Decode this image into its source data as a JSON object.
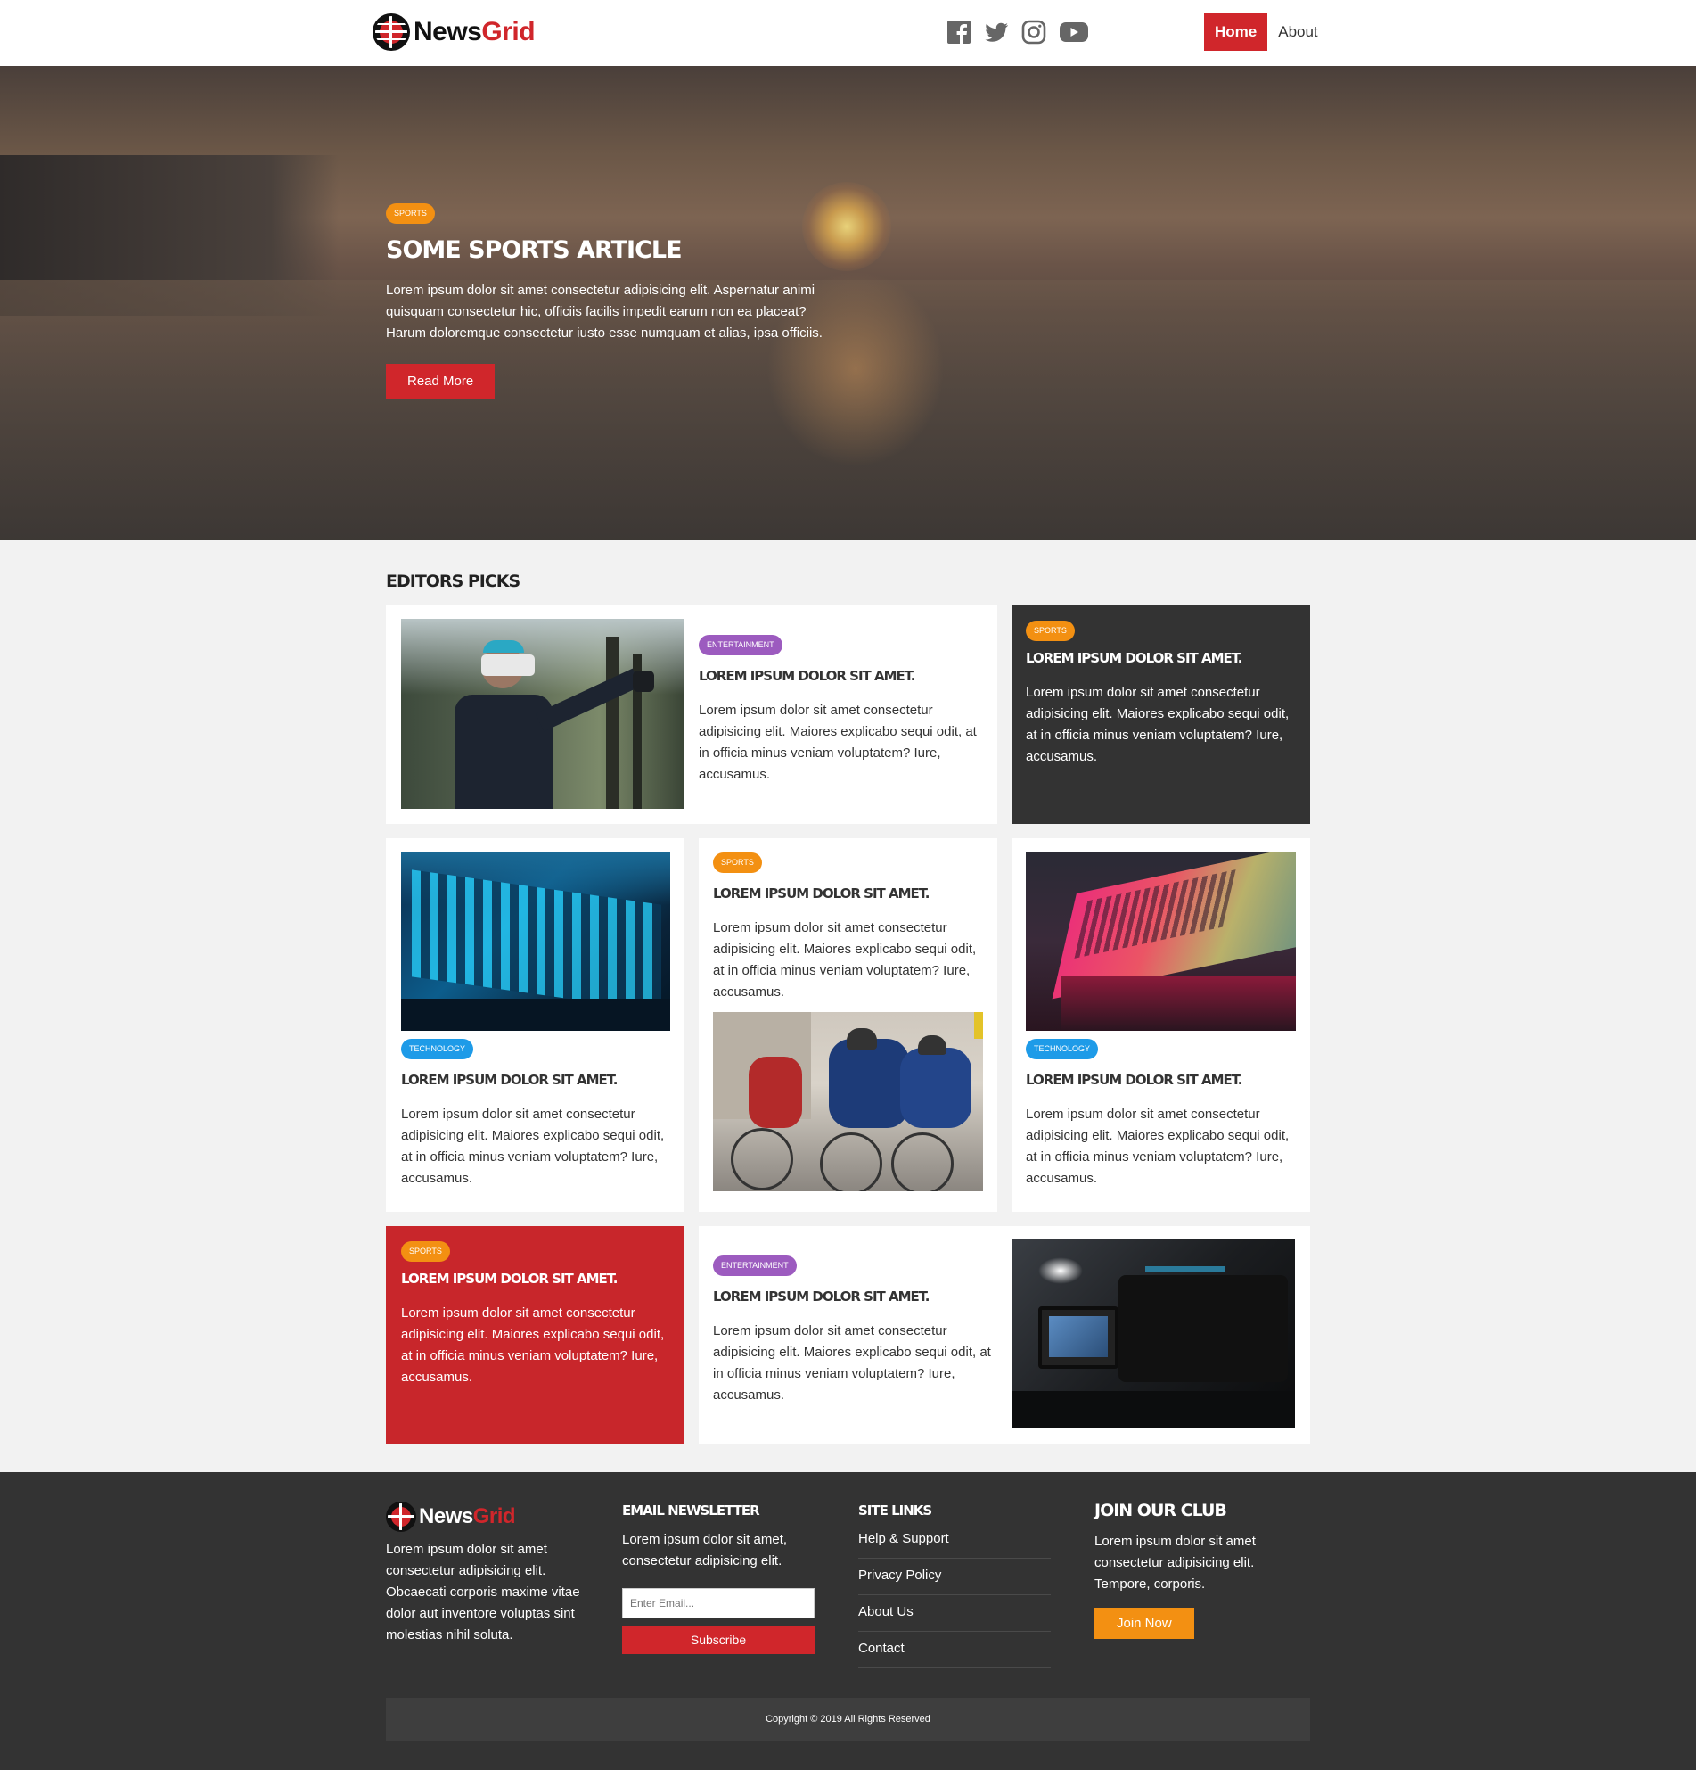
{
  "brand": {
    "part1": "News",
    "part2": "Grid"
  },
  "social": [
    "facebook-icon",
    "twitter-icon",
    "instagram-icon",
    "youtube-icon"
  ],
  "nav": {
    "home": "Home",
    "about": "About"
  },
  "hero": {
    "badge": "Sports",
    "title": "Some Sports Article",
    "text": "Lorem ipsum dolor sit amet consectetur adipisicing elit. Aspernatur animi quisquam consectetur hic, officiis facilis impedit earum non ea placeat? Harum doloremque consectetur iusto esse numquam et alias, ipsa officiis.",
    "button": "Read More"
  },
  "picks": {
    "title": "Editors Picks",
    "cards": [
      {
        "badge": "Entertainment",
        "title": "Lorem ipsum dolor sit amet.",
        "text": "Lorem ipsum dolor sit amet consectetur adipisicing elit. Maiores explicabo sequi odit, at in officia minus veniam voluptatem? Iure, accusamus."
      },
      {
        "badge": "Sports",
        "title": "Lorem ipsum dolor sit amet.",
        "text": "Lorem ipsum dolor sit amet consectetur adipisicing elit. Maiores explicabo sequi odit, at in officia minus veniam voluptatem? Iure, accusamus."
      },
      {
        "badge": "Technology",
        "title": "Lorem ipsum dolor sit amet.",
        "text": "Lorem ipsum dolor sit amet consectetur adipisicing elit. Maiores explicabo sequi odit, at in officia minus veniam voluptatem? Iure, accusamus."
      },
      {
        "badge": "Sports",
        "title": "Lorem ipsum dolor sit amet.",
        "text": "Lorem ipsum dolor sit amet consectetur adipisicing elit. Maiores explicabo sequi odit, at in officia minus veniam voluptatem? Iure, accusamus."
      },
      {
        "badge": "Technology",
        "title": "Lorem ipsum dolor sit amet.",
        "text": "Lorem ipsum dolor sit amet consectetur adipisicing elit. Maiores explicabo sequi odit, at in officia minus veniam voluptatem? Iure, accusamus."
      },
      {
        "badge": "Sports",
        "title": "Lorem ipsum dolor sit amet.",
        "text": "Lorem ipsum dolor sit amet consectetur adipisicing elit. Maiores explicabo sequi odit, at in officia minus veniam voluptatem? Iure, accusamus."
      },
      {
        "badge": "Entertainment",
        "title": "Lorem ipsum dolor sit amet.",
        "text": "Lorem ipsum dolor sit amet consectetur adipisicing elit. Maiores explicabo sequi odit, at in officia minus veniam voluptatem? Iure, accusamus."
      }
    ]
  },
  "footer": {
    "about_text": "Lorem ipsum dolor sit amet consectetur adipisicing elit. Obcaecati corporis maxime vitae dolor aut inventore voluptas sint molestias nihil soluta.",
    "newsletter": {
      "title": "Email Newsletter",
      "text": "Lorem ipsum dolor sit amet, consectetur adipisicing elit.",
      "placeholder": "Enter Email...",
      "button": "Subscribe"
    },
    "sitelinks": {
      "title": "Site Links",
      "links": [
        "Help & Support",
        "Privacy Policy",
        "About Us",
        "Contact"
      ]
    },
    "club": {
      "title": "Join Our Club",
      "text": "Lorem ipsum dolor sit amet consectetur adipisicing elit. Tempore, corporis.",
      "button": "Join Now"
    },
    "copyright": "Copyright © 2019 All Rights Reserved"
  },
  "colors": {
    "accent": "#d0262b",
    "sports": "#f39012",
    "entertainment": "#9c5bbf",
    "technology": "#1e9be8",
    "dark": "#333333"
  }
}
